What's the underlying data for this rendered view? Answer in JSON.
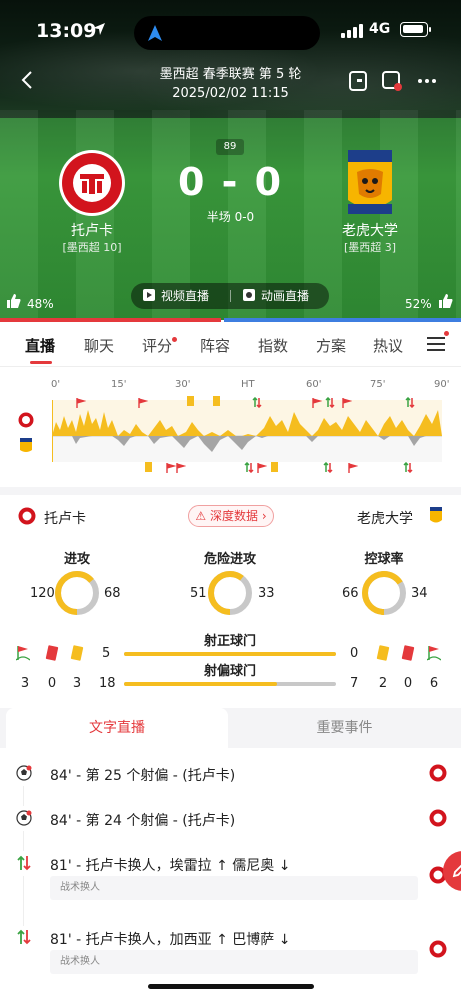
{
  "status_bar": {
    "time": "13:09",
    "network": "4G"
  },
  "header": {
    "match_title": "墨西超 春季联赛 第 5 轮",
    "match_datetime": "2025/02/02 11:15"
  },
  "match": {
    "minute": "89",
    "score": "0 - 0",
    "half_time": "半场 0-0",
    "home": {
      "name": "托卢卡",
      "rank": "[墨西超 10]"
    },
    "away": {
      "name": "老虎大学",
      "rank": "[墨西超 3]"
    }
  },
  "live_buttons": {
    "video": "视频直播",
    "animation": "动画直播"
  },
  "votes": {
    "home_percent": "48%",
    "away_percent": "52%",
    "home_fraction": 0.48
  },
  "tabs": [
    {
      "label": "直播"
    },
    {
      "label": "聊天"
    },
    {
      "label": "评分"
    },
    {
      "label": "阵容"
    },
    {
      "label": "指数"
    },
    {
      "label": "方案"
    },
    {
      "label": "热议"
    }
  ],
  "timeline": {
    "ticks": [
      "0'",
      "15'",
      "30'",
      "HT",
      "60'",
      "75'",
      "90'"
    ]
  },
  "stats": {
    "home_name": "托卢卡",
    "away_name": "老虎大学",
    "deep_data_label": "深度数据",
    "attack": {
      "title": "进攻",
      "home": "120",
      "away": "68",
      "home_share": 0.638
    },
    "dangerous_attack": {
      "title": "危险进攻",
      "home": "51",
      "away": "33",
      "home_share": 0.607
    },
    "possession": {
      "title": "控球率",
      "home": "66",
      "away": "34",
      "home_share": 0.66
    },
    "shots_on_target": {
      "title": "射正球门",
      "home": "5",
      "away": "0",
      "home_share": 1.0
    },
    "shots_off_target": {
      "title": "射偏球门",
      "home": "18",
      "away": "7",
      "home_share": 0.72
    },
    "home_counts": {
      "corners": "3",
      "red_cards": "0",
      "yellow_cards": "3"
    },
    "away_counts": {
      "yellow_cards": "2",
      "red_cards": "0",
      "corners": "6"
    }
  },
  "live_text": {
    "tab_active": "文字直播",
    "tab_other": "重要事件",
    "events": [
      {
        "text": "84' - 第 25 个射偏 - (托卢卡)",
        "icon": "shot-off-icon"
      },
      {
        "text": "84' - 第 24 个射偏 - (托卢卡)",
        "icon": "shot-off-icon"
      },
      {
        "text": "81' - 托卢卡换人，埃雷拉 ↑ 儒尼奥 ↓",
        "icon": "substitution-icon",
        "note": "战术换人"
      },
      {
        "text": "81' - 托卢卡换人，加西亚 ↑ 巴博萨 ↓",
        "icon": "substitution-icon",
        "note": "战术换人"
      }
    ]
  },
  "colors": {
    "accent": "#e4393c",
    "home_bar": "#e4393c",
    "away_bar": "#3d7ee0",
    "gauge_home": "#f5bd1f",
    "gauge_away": "#c8c8c8"
  }
}
